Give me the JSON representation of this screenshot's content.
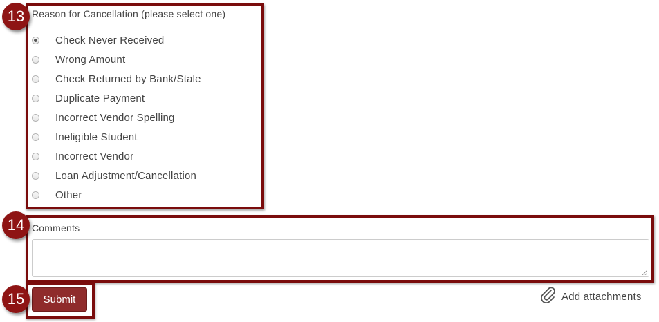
{
  "annotations": {
    "reason_badge": "13",
    "comments_badge": "14",
    "submit_badge": "15",
    "accent_color": "#7a0c0c"
  },
  "reason": {
    "label": "Reason for Cancellation (please select one)",
    "selected": "Check Never Received",
    "options": [
      {
        "label": "Check Never Received",
        "checked": true
      },
      {
        "label": "Wrong Amount",
        "checked": false
      },
      {
        "label": "Check Returned by Bank/Stale",
        "checked": false
      },
      {
        "label": "Duplicate Payment",
        "checked": false
      },
      {
        "label": "Incorrect Vendor Spelling",
        "checked": false
      },
      {
        "label": "Ineligible Student",
        "checked": false
      },
      {
        "label": "Incorrect Vendor",
        "checked": false
      },
      {
        "label": "Loan Adjustment/Cancellation",
        "checked": false
      },
      {
        "label": "Other",
        "checked": false
      }
    ]
  },
  "comments": {
    "label": "Comments",
    "value": ""
  },
  "actions": {
    "submit_label": "Submit",
    "attach_label": "Add attachments",
    "attach_icon": "paperclip-icon",
    "submit_color": "#8f2b2b"
  }
}
